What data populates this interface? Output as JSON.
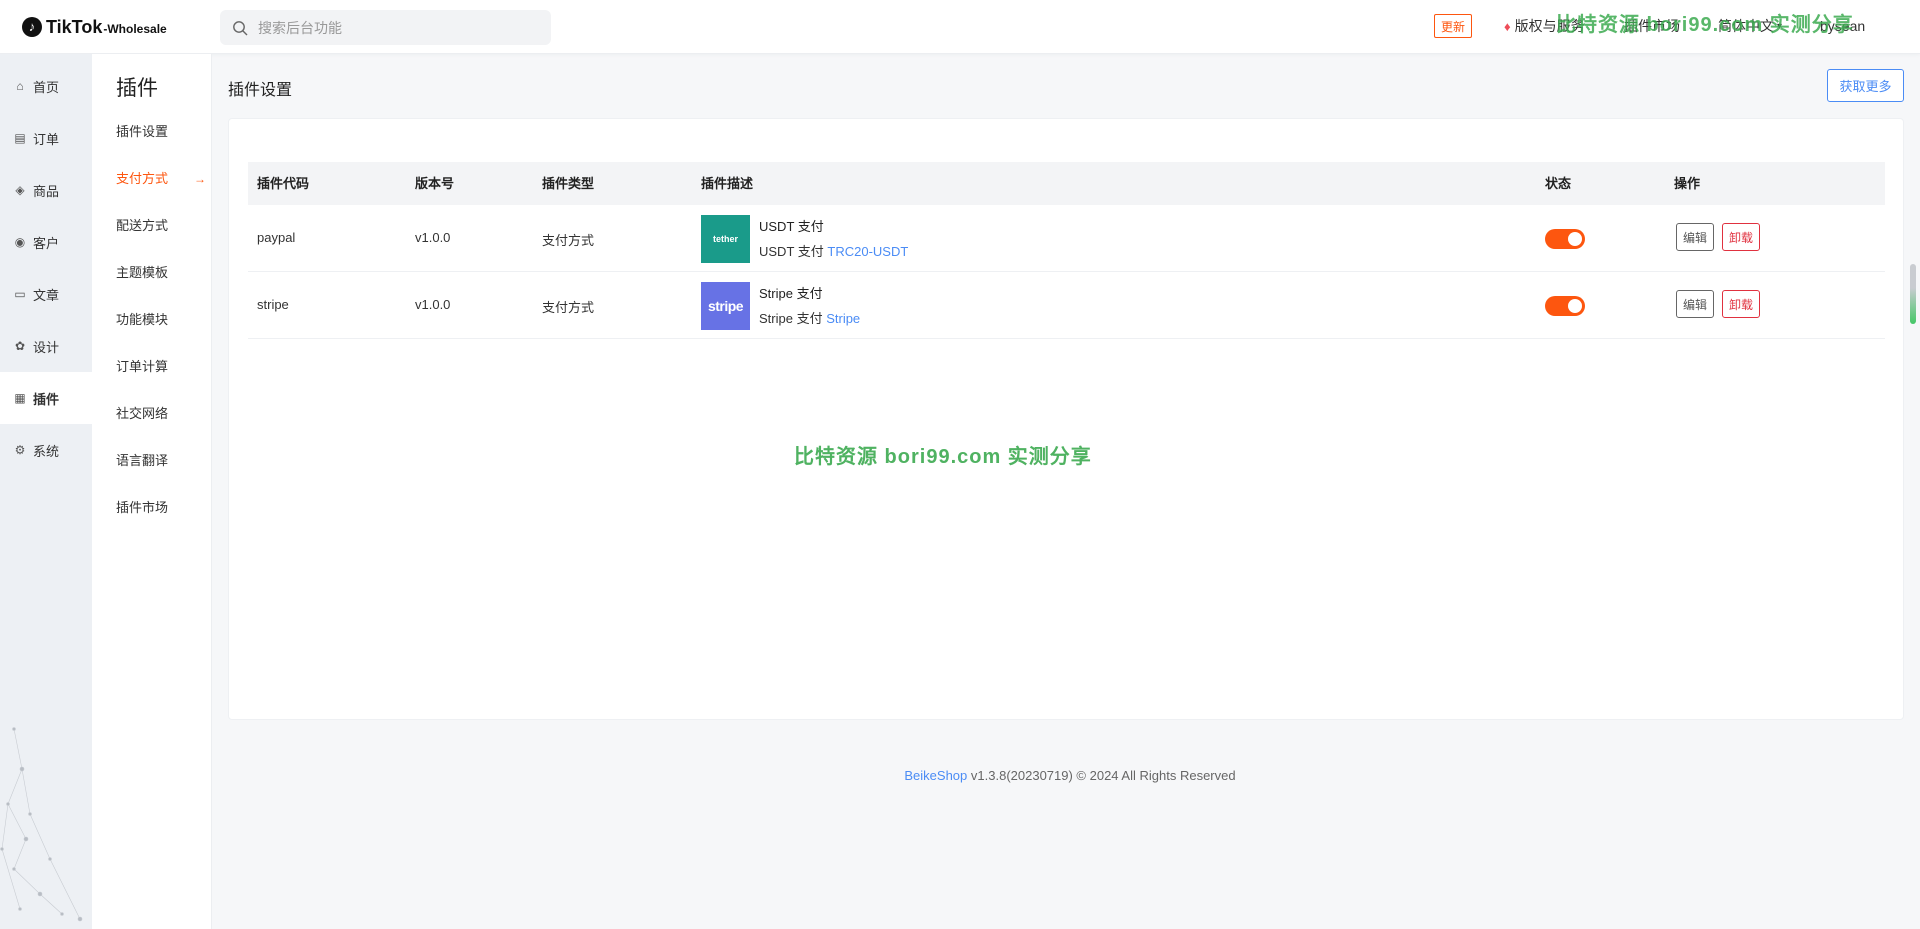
{
  "header": {
    "logo_brand": "TikTok",
    "logo_suffix": "-Wholesale",
    "search_placeholder": "搜索后台功能",
    "update_label": "更新",
    "copyright_label": "版权与服务",
    "market_label": "插件市场",
    "language_label": "简体中文",
    "user_label": "bysean",
    "watermark": "比特资源 bori99.com 实测分享"
  },
  "rail": {
    "items": [
      {
        "label": "首页",
        "icon": "home-icon"
      },
      {
        "label": "订单",
        "icon": "order-icon"
      },
      {
        "label": "商品",
        "icon": "box-icon"
      },
      {
        "label": "客户",
        "icon": "user-icon"
      },
      {
        "label": "文章",
        "icon": "article-icon"
      },
      {
        "label": "设计",
        "icon": "palette-icon"
      },
      {
        "label": "插件",
        "icon": "plugin-icon"
      },
      {
        "label": "系统",
        "icon": "gear-icon"
      }
    ],
    "active_index": 6
  },
  "subnav": {
    "title": "插件",
    "items": [
      "插件设置",
      "支付方式",
      "配送方式",
      "主题模板",
      "功能模块",
      "订单计算",
      "社交网络",
      "语言翻译",
      "插件市场"
    ],
    "active_index": 1
  },
  "main": {
    "page_title": "插件设置",
    "more_button": "获取更多",
    "columns": [
      "插件代码",
      "版本号",
      "插件类型",
      "插件描述",
      "状态",
      "操作"
    ],
    "rows": [
      {
        "code": "paypal",
        "version": "v1.0.0",
        "type": "支付方式",
        "logo_text": "tether",
        "name": "USDT 支付",
        "desc_prefix": "USDT 支付",
        "desc_link": "TRC20-USDT",
        "enabled": true,
        "edit_label": "编辑",
        "uninstall_label": "卸载"
      },
      {
        "code": "stripe",
        "version": "v1.0.0",
        "type": "支付方式",
        "logo_text": "stripe",
        "name": "Stripe 支付",
        "desc_prefix": "Stripe 支付",
        "desc_link": "Stripe",
        "enabled": true,
        "edit_label": "编辑",
        "uninstall_label": "卸载"
      }
    ],
    "watermark": "比特资源 bori99.com 实测分享"
  },
  "footer": {
    "brand": "BeikeShop",
    "text": "v1.3.8(20230719) © 2024 All Rights Reserved"
  },
  "colors": {
    "accent": "#fd560f",
    "link": "#4b8cf5",
    "danger": "#e0313f"
  }
}
